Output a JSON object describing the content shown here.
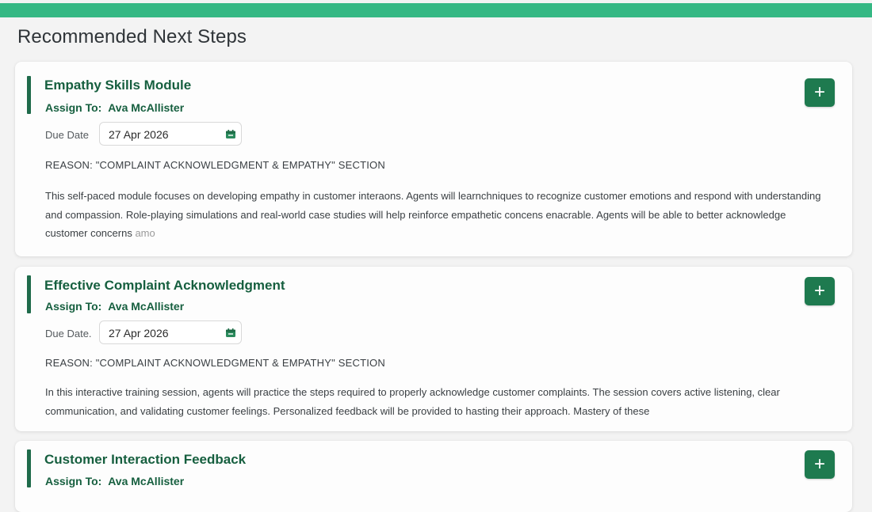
{
  "page": {
    "title": "Recommended Next Steps",
    "accent_color": "#35b884",
    "brand_green": "#1e7a4f"
  },
  "cards": [
    {
      "title": "Empathy Skills Module",
      "assign_label": "Assign To:",
      "assignee": "Ava McAllister",
      "add_icon": "plus-icon",
      "add_label": "+",
      "due_label": "Due Date",
      "due_date": "27 Apr 2026",
      "calendar_icon": "calendar-icon",
      "reason": "REASON:  \"COMPLAINT ACKNOWLEDGMENT  &  EMPATHY\"  SECTION",
      "description": "This self-paced module focuses on developing empathy in customer interaons. Agents will learnchniques to recognize customer emotions and respond with understanding and compassion. Role-playing simulations and real-world case studies will help reinforce empathetic concens enacrable. Agents will be able to better acknowledge customer concerns",
      "description_fade": "amo"
    },
    {
      "title": "Effective Complaint Acknowledgment",
      "assign_label": "Assign To:",
      "assignee": "Ava McAllister",
      "add_icon": "plus-icon",
      "add_label": "+",
      "due_label": "Due Date.",
      "due_date": "27 Apr 2026",
      "calendar_icon": "calendar-icon",
      "reason": "REASON:  \"COMPLAINT ACKNOWLEDGMENT  &  EMPATHY\"  SECTION",
      "description": "In this interactive training session, agents will practice the steps required to properly acknowledge customer complaints. The session covers active listening, clear communication, and validating customer feelings. Personalized feedback will be provided to hasting their approach. Mastery of these"
    },
    {
      "title": "Customer Interaction Feedback",
      "assign_label": "Assign To:",
      "assignee": "Ava McAllister",
      "add_icon": "plus-icon",
      "add_label": "+"
    }
  ]
}
